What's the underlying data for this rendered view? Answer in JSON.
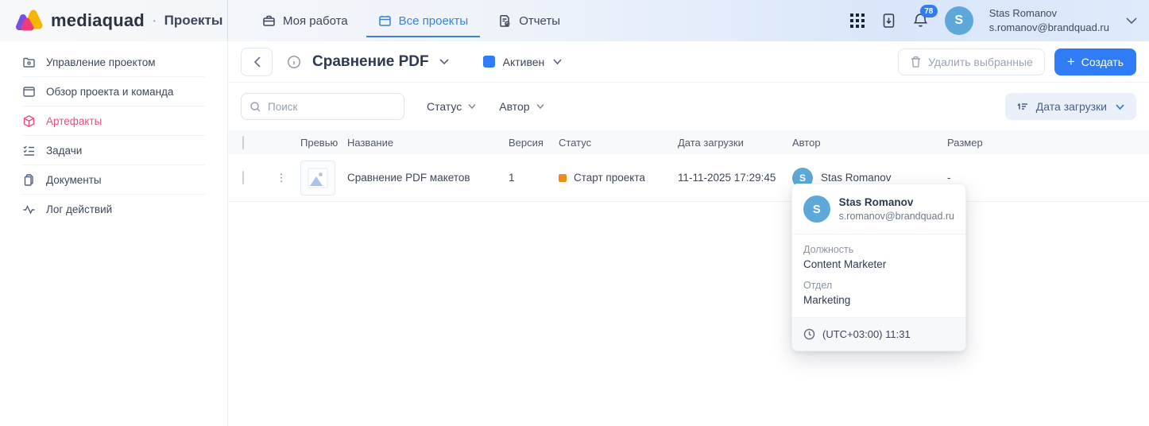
{
  "brand": {
    "name": "mediaquad",
    "section": "Проекты"
  },
  "topnav": {
    "tabs": [
      {
        "label": "Моя работа"
      },
      {
        "label": "Все проекты"
      },
      {
        "label": "Отчеты"
      }
    ],
    "notification_count": "78",
    "user": {
      "initial": "S",
      "name": "Stas Romanov",
      "email": "s.romanov@brandquad.ru"
    }
  },
  "sidebar": {
    "items": [
      {
        "label": "Управление проектом"
      },
      {
        "label": "Обзор проекта и команда"
      },
      {
        "label": "Артефакты"
      },
      {
        "label": "Задачи"
      },
      {
        "label": "Документы"
      },
      {
        "label": "Лог действий"
      }
    ]
  },
  "toolbar": {
    "title": "Сравнение PDF",
    "status_label": "Активен",
    "delete_label": "Удалить выбранные",
    "create_label": "Создать",
    "create_plus": "+"
  },
  "filters": {
    "search_placeholder": "Поиск",
    "status_label": "Статус",
    "author_label": "Автор",
    "sort_label": "Дата загрузки"
  },
  "table": {
    "headers": {
      "preview": "Превью",
      "name": "Название",
      "version": "Версия",
      "status": "Статус",
      "date": "Дата загрузки",
      "author": "Автор",
      "size": "Размер"
    },
    "rows": [
      {
        "name": "Сравнение PDF макетов",
        "version": "1",
        "status": "Старт проекта",
        "date": "11-11-2025 17:29:45",
        "author": "Stas Romanov",
        "author_initial": "S",
        "size": "-",
        "kebab": "⋮"
      }
    ]
  },
  "popover": {
    "initial": "S",
    "name": "Stas Romanov",
    "email": "s.romanov@brandquad.ru",
    "position_label": "Должность",
    "position_value": "Content Marketer",
    "department_label": "Отдел",
    "department_value": "Marketing",
    "timezone": "(UTC+03:00) 11:31"
  },
  "colors": {
    "accent_blue": "#2f7cf6",
    "active_pink": "#ee4d7b",
    "status_orange": "#ef8d1a",
    "avatar_blue": "#5da8d8"
  }
}
